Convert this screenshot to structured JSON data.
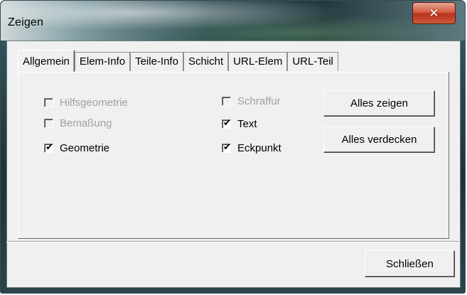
{
  "window": {
    "title": "Zeigen",
    "close_label": "✕"
  },
  "tabs": [
    {
      "label": "Allgemein",
      "active": true
    },
    {
      "label": "Elem-Info",
      "active": false
    },
    {
      "label": "Teile-Info",
      "active": false
    },
    {
      "label": "Schicht",
      "active": false
    },
    {
      "label": "URL-Elem",
      "active": false
    },
    {
      "label": "URL-Teil",
      "active": false
    }
  ],
  "checkboxes": {
    "hilfsgeometrie": {
      "label": "Hilfsgeometrie",
      "checked": false,
      "enabled": false
    },
    "bemassung": {
      "label": "Bemaßung",
      "checked": false,
      "enabled": false
    },
    "geometrie": {
      "label": "Geometrie",
      "checked": true,
      "enabled": true
    },
    "schraffur": {
      "label": "Schraffur",
      "checked": false,
      "enabled": false
    },
    "text": {
      "label": "Text",
      "checked": true,
      "enabled": true
    },
    "eckpunkt": {
      "label": "Eckpunkt",
      "checked": true,
      "enabled": true
    },
    "check_glyph": "✔"
  },
  "buttons": {
    "show_all": "Alles zeigen",
    "hide_all": "Alles verdecken",
    "close": "Schließen"
  }
}
